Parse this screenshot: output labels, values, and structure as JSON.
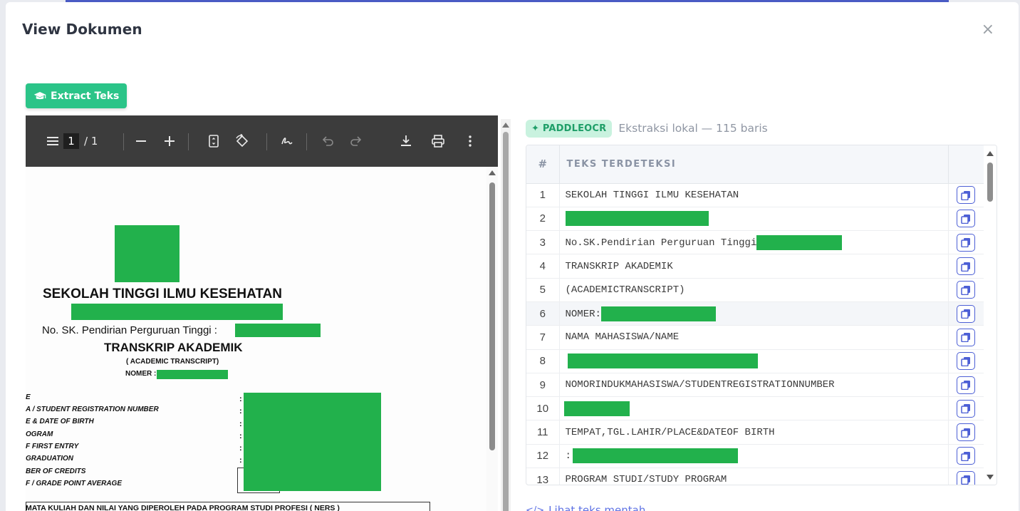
{
  "modal": {
    "title": "View Dokumen",
    "close_label": "×",
    "extract_button_label": "Extract Teks"
  },
  "pdf_toolbar": {
    "current_page": "1",
    "page_total": "/ 1"
  },
  "document": {
    "school_name": "SEKOLAH TINGGI ILMU KESEHATAN",
    "sk_label": "No. SK. Pendirian Perguruan Tinggi :",
    "title": "TRANSKRIP AKADEMIK",
    "subtitle": "( ACADEMIC TRANSCRIPT)",
    "nomer_label": "NOMER :",
    "fields": [
      "E",
      "A / STUDENT REGISTRATION NUMBER",
      "E & DATE OF BIRTH",
      "OGRAM",
      "F FIRST ENTRY",
      "GRADUATION",
      "BER OF CREDITS",
      "F / GRADE POINT AVERAGE"
    ],
    "footer_line": "MATA KULIAH DAN NILAI YANG DIPEROLEH PADA PROGRAM STUDI PROFESI ( NERS )"
  },
  "ocr": {
    "badge": "✦ PADDLEOCR",
    "info": "Ekstraksi lokal — 115 baris",
    "col_num": "#",
    "col_text": "TEKS TERDETEKSI",
    "rows": [
      {
        "n": "1",
        "text": "SEKOLAH TINGGI ILMU KESEHATAN"
      },
      {
        "n": "2",
        "text": ""
      },
      {
        "n": "3",
        "text": "No.SK.Pendirian Perguruan Tinggi"
      },
      {
        "n": "4",
        "text": "TRANSKRIP AKADEMIK"
      },
      {
        "n": "5",
        "text": "(ACADEMICTRANSCRIPT)"
      },
      {
        "n": "6",
        "text": "NOMER:"
      },
      {
        "n": "7",
        "text": "NAMA MAHASISWA/NAME"
      },
      {
        "n": "8",
        "text": ""
      },
      {
        "n": "9",
        "text": "NOMORINDUKMAHASISWA/STUDENTREGISTRATIONNUMBER"
      },
      {
        "n": "10",
        "text": ""
      },
      {
        "n": "11",
        "text": "TEMPAT,TGL.LAHIR/PLACE&DATEOF BIRTH"
      },
      {
        "n": "12",
        "text": ":"
      },
      {
        "n": "13",
        "text": "PROGRAM STUDI/STUDY PROGRAM"
      }
    ],
    "raw_link": "Lihat teks mentah"
  },
  "colors": {
    "accent_green": "#2bc488",
    "redaction": "#22b14c",
    "copy_button": "#4c5fd5"
  }
}
